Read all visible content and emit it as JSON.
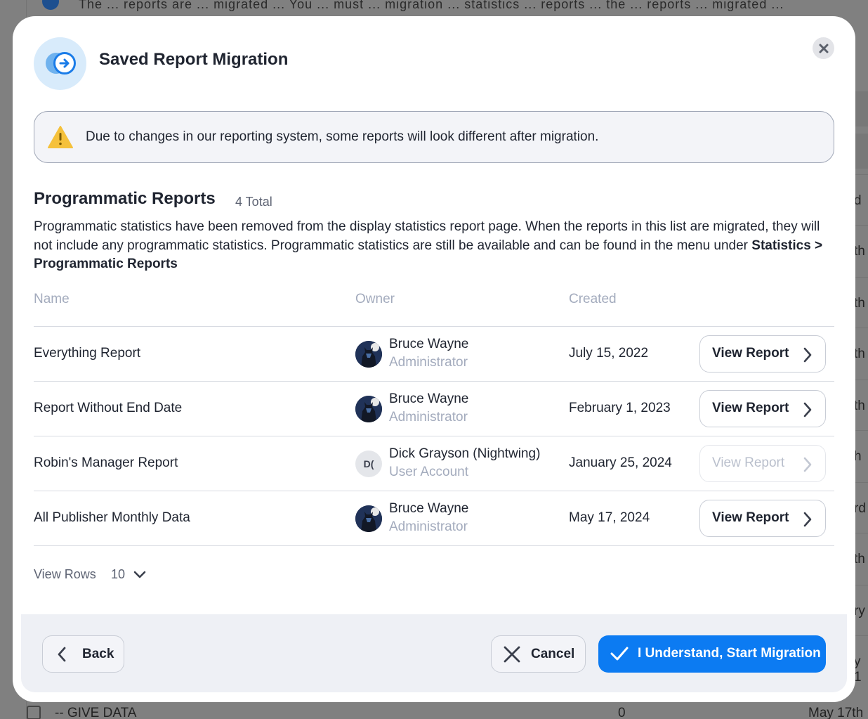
{
  "background": {
    "top_text": "The ... reports are ... migrated ... You ... must ... migration ... statistics ... reports ... the ... reports ... migrated ...",
    "right_fragments": [
      "d",
      "th",
      "th",
      "th",
      "th",
      "h",
      "rd",
      "th",
      "ry",
      "y 1"
    ],
    "bottom_row": {
      "name": "-- GIVE DATA",
      "value": "0",
      "date": "May 17th"
    }
  },
  "modal": {
    "title": "Saved Report Migration",
    "header_icon": "migration-arrow-icon",
    "close_icon": "close-icon",
    "notice": {
      "icon": "warning-icon",
      "text": "Due to changes in our reporting system, some reports will look different after migration."
    },
    "section": {
      "title": "Programmatic Reports",
      "count": "4 Total",
      "desc_part1": "Programmatic statistics have been removed from the display statistics report page. When the reports in this list are migrated, they will not include any programmatic statistics. Programmatic statistics are still be available and can be found in the menu under ",
      "desc_bold1": "Statistics",
      "desc_sep": " > ",
      "desc_bold2": "Programmatic Reports"
    },
    "table": {
      "columns": {
        "name": "Name",
        "owner": "Owner",
        "created": "Created"
      },
      "rows": [
        {
          "name": "Everything Report",
          "owner_name": "Bruce Wayne",
          "owner_role": "Administrator",
          "avatar": "batman",
          "created": "July 15, 2022",
          "action": "View Report",
          "enabled": true
        },
        {
          "name": "Report Without End Date",
          "owner_name": "Bruce Wayne",
          "owner_role": "Administrator",
          "avatar": "batman",
          "created": "February 1, 2023",
          "action": "View Report",
          "enabled": true
        },
        {
          "name": "Robin's Manager Report",
          "owner_name": "Dick Grayson (Nightwing)",
          "owner_role": "User Account",
          "avatar": "D(",
          "created": "January 25, 2024",
          "action": "View Report",
          "enabled": false
        },
        {
          "name": "All Publisher Monthly Data",
          "owner_name": "Bruce Wayne",
          "owner_role": "Administrator",
          "avatar": "batman",
          "created": "May 17, 2024",
          "action": "View Report",
          "enabled": true
        }
      ]
    },
    "pagination": {
      "label": "View Rows",
      "value": "10"
    },
    "footer": {
      "back": "Back",
      "cancel": "Cancel",
      "confirm": "I Understand, Start Migration"
    },
    "colors": {
      "primary": "#0c7bf2",
      "warning": "#f5c13b",
      "muted": "#a3abbd"
    }
  }
}
